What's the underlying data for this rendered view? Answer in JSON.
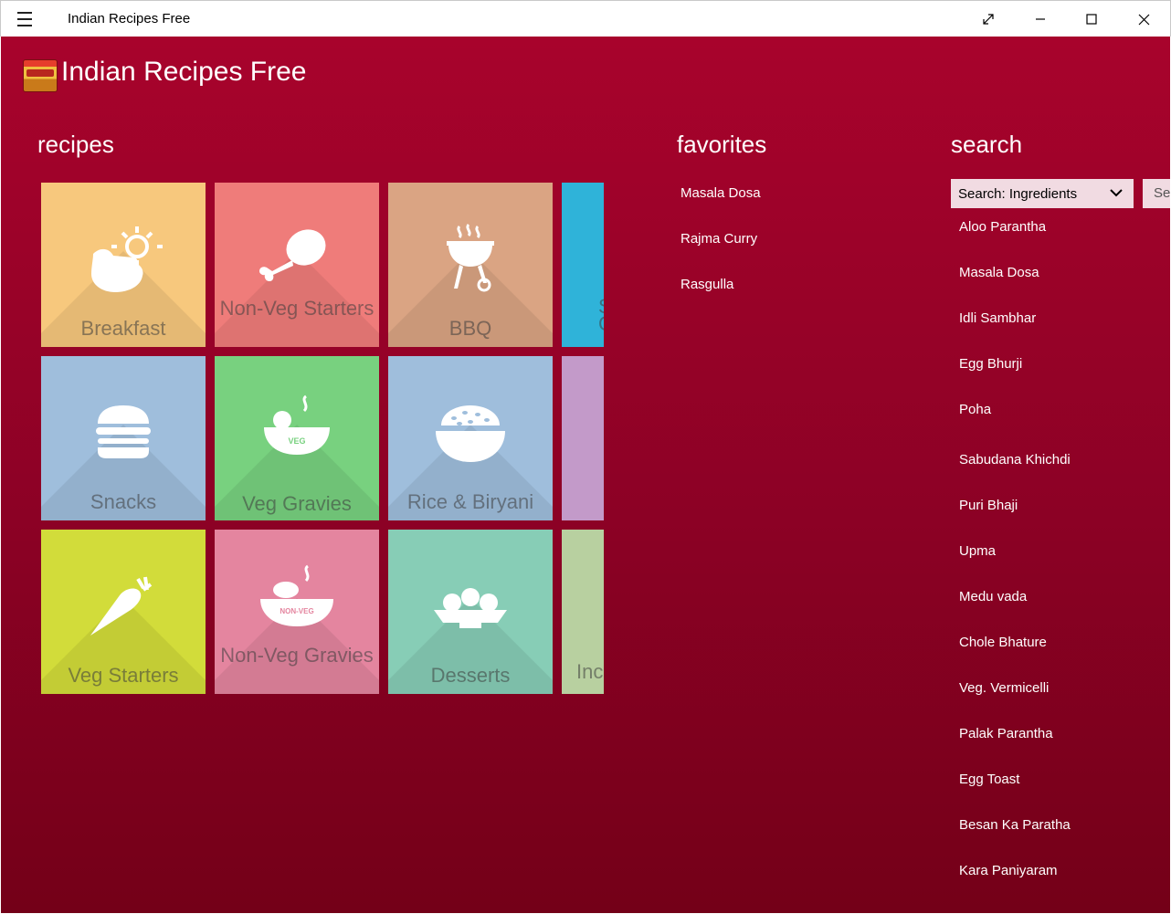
{
  "window": {
    "title": "Indian Recipes Free",
    "menu_icon": "hamburger-icon",
    "controls": [
      "fullscreen-icon",
      "minimize-icon",
      "maximize-icon",
      "close-icon"
    ]
  },
  "app": {
    "title": "Indian Recipes Free",
    "logo": "app-logo",
    "background": "#9a0227"
  },
  "recipes": {
    "title": "recipes",
    "tiles": [
      {
        "label": "Breakfast",
        "color": "#f7c87d",
        "icon": "breakfast-icon"
      },
      {
        "label": "Non-Veg Starters",
        "color": "#ef7c7a",
        "icon": "chicken-leg-icon"
      },
      {
        "label": "BBQ",
        "color": "#daa483",
        "icon": "grill-icon"
      },
      {
        "label": "S C",
        "color": "#2fb3d9",
        "icon": ""
      },
      {
        "label": "Snacks",
        "color": "#9fbedc",
        "icon": "burger-icon"
      },
      {
        "label": "Veg Gravies",
        "color": "#78d17f",
        "icon": "veg-bowl-icon"
      },
      {
        "label": "Rice & Biryani",
        "color": "#9fbedc",
        "icon": "rice-bowl-icon"
      },
      {
        "label": "",
        "color": "#c39ac9",
        "icon": ""
      },
      {
        "label": "Veg Starters",
        "color": "#d2dc3a",
        "icon": "carrot-icon"
      },
      {
        "label": "Non-Veg Gravies",
        "color": "#e4859f",
        "icon": "nonveg-bowl-icon"
      },
      {
        "label": "Desserts",
        "color": "#87cdb6",
        "icon": "dessert-plate-icon"
      },
      {
        "label": "Inc",
        "color": "#b8d0a0",
        "icon": ""
      }
    ]
  },
  "favorites": {
    "title": "favorites",
    "items": [
      "Masala Dosa",
      "Rajma Curry",
      "Rasgulla"
    ]
  },
  "search": {
    "title": "search",
    "select_value": "Search: Ingredients",
    "button_label": "Sea",
    "results": [
      "Aloo Parantha",
      "Masala Dosa",
      "Idli Sambhar",
      "Egg Bhurji",
      "Poha",
      "Sabudana Khichdi",
      "Puri Bhaji",
      "Upma",
      "Medu vada",
      "Chole Bhature",
      "Veg. Vermicelli",
      "Palak Parantha",
      "Egg Toast",
      "Besan Ka Paratha",
      "Kara Paniyaram"
    ]
  }
}
